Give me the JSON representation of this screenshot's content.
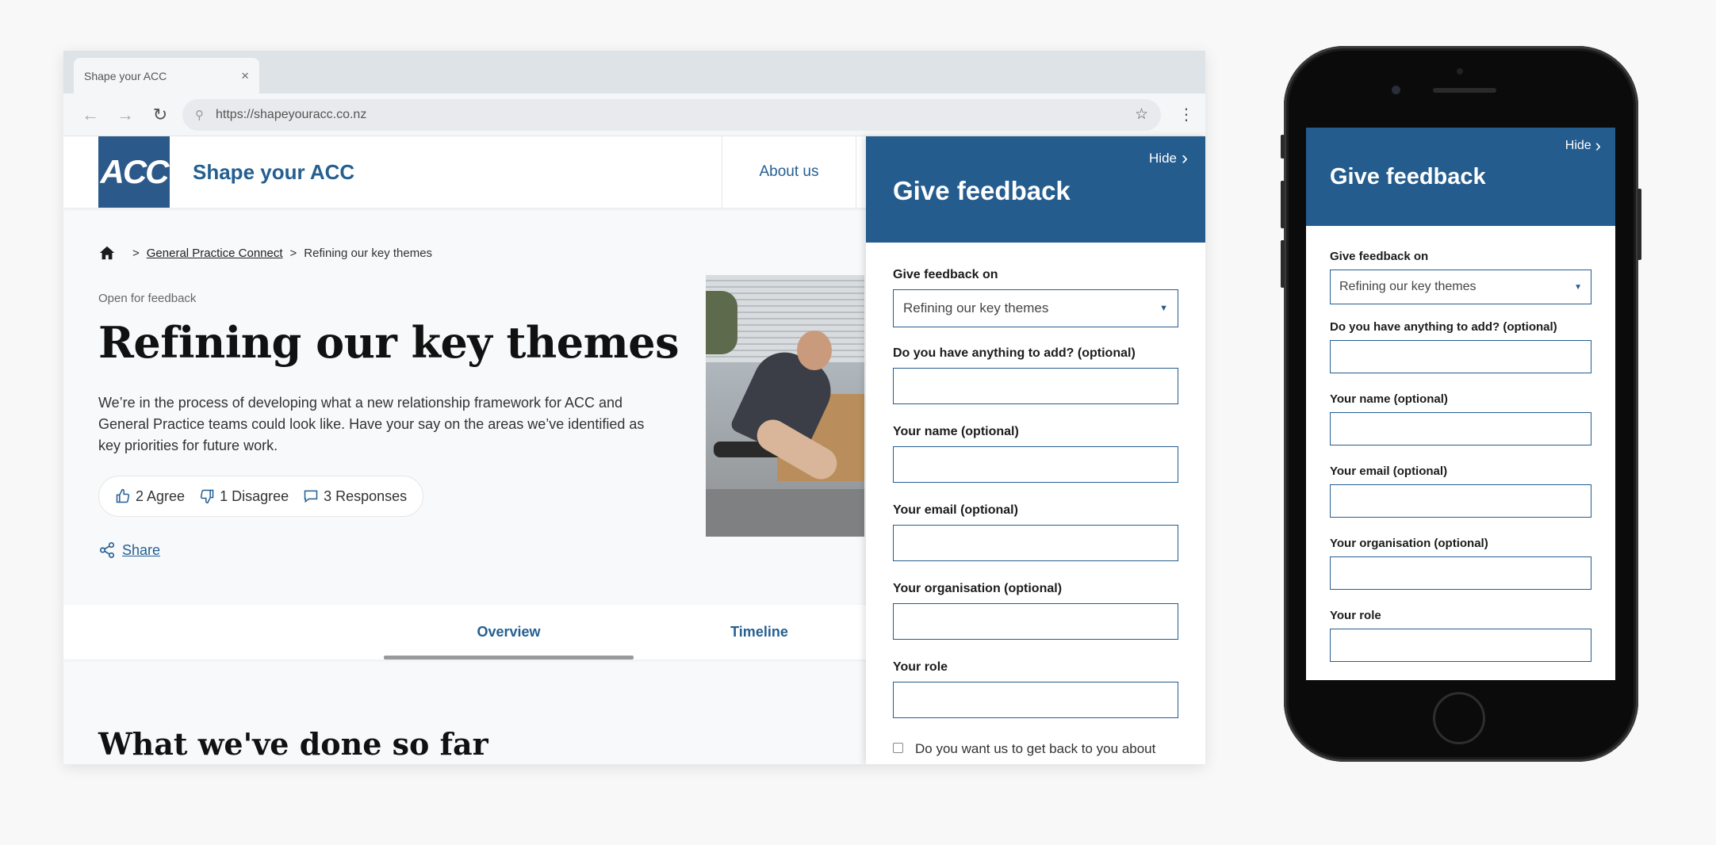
{
  "browser": {
    "tab_title": "Shape your ACC",
    "url": "https://shapeyouracc.co.nz"
  },
  "site": {
    "logo_text": "ACC",
    "name": "Shape your ACC",
    "nav_about": "About us"
  },
  "breadcrumb": {
    "sep": ">",
    "items": [
      "General Practice Connect",
      "Refining our key themes"
    ]
  },
  "hero": {
    "status": "Open for feedback",
    "title": "Refining our key themes",
    "description": "We’re in the process of developing what a new relationship framework for ACC and General Practice teams could look like. Have your say on the areas we’ve identified as key priorities for future work.",
    "agree": "2 Agree",
    "disagree": "1 Disagree",
    "responses": "3 Responses",
    "share": "Share"
  },
  "tabs": {
    "overview": "Overview",
    "timeline": "Timeline",
    "active": "overview"
  },
  "section_title": "What we've done so far",
  "feedback": {
    "hide": "Hide",
    "title": "Give feedback",
    "on_label": "Give feedback on",
    "on_value": "Refining our key themes",
    "add_label": "Do you have anything to add? (optional)",
    "name_label": "Your name (optional)",
    "email_label": "Your email (optional)",
    "org_label": "Your organisation (optional)",
    "role_label": "Your role",
    "contact_label": "Do you want us to get back to you about your feedback?",
    "add_value": "",
    "name_value": "",
    "email_value": "",
    "org_value": "",
    "role_value": ""
  },
  "icons": {
    "back": "arrow-left-icon",
    "forward": "arrow-right-icon",
    "reload": "reload-icon",
    "search": "search-icon",
    "star": "star-icon",
    "menu": "vertical-dots-icon",
    "home": "home-icon",
    "agree": "thumbs-up-icon",
    "disagree": "thumbs-down-icon",
    "responses": "speech-bubble-icon",
    "share": "share-icon",
    "hide": "chevron-right-icon",
    "caret": "caret-down-icon"
  },
  "colors": {
    "brand": "#255c8e",
    "header_text": "#245f91",
    "tab_underline": "#9a9a9a"
  }
}
